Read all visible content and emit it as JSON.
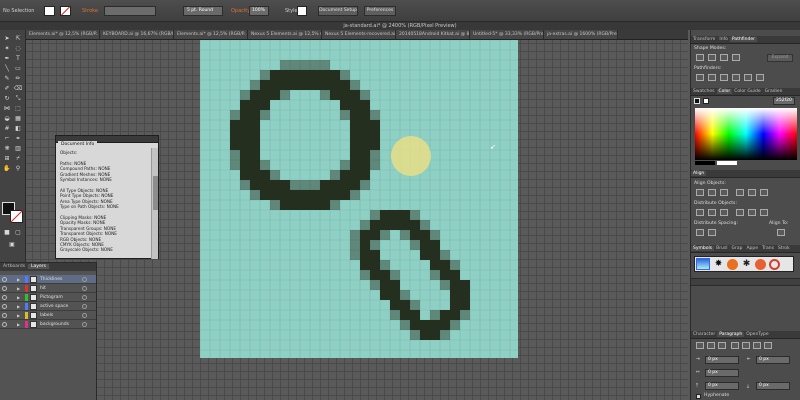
{
  "control_bar": {
    "selection": "No Selection",
    "stroke_label": "Stroke",
    "brush_value": "5 pt. Round",
    "opacity_label": "Opacity",
    "opacity_value": "100%",
    "style_label": "Style",
    "document_setup": "Document Setup",
    "preferences": "Preferences"
  },
  "document_title": "ja-standard.ai* @ 2400% (RGB/Pixel Preview)",
  "tabs": [
    {
      "label": "Elements.ai* @ 12,5% (RGB/P..."
    },
    {
      "label": "KEYBOARD.ai @ 16,67% (RGB/Pixel P..."
    },
    {
      "label": "Elements.ai* @ 12,5% (RGB/P..."
    },
    {
      "label": "Nexus 5 Elements.ai @ 12,5% (RGB/P..."
    },
    {
      "label": "Nexus 5 Elements-recovered.ai @ 6,2..."
    },
    {
      "label": "20140518Android Kitkat.ai @ 8,33% (..."
    },
    {
      "label": "Untitled-5* @ 33,33% (RGB/Previe..."
    },
    {
      "label": "ja-extras.ai @ 1600% (RGB/Previe..."
    }
  ],
  "document_info": {
    "tab": "Document Info",
    "lines": [
      "Objects:",
      "",
      "Paths: NONE",
      "Compound Paths: NONE",
      "Gradient Meshes: NONE",
      "Symbol Instances: NONE",
      "",
      "All Type Objects: NONE",
      "Point Type Objects: NONE",
      "Area Type Objects: NONE",
      "Type on Path Objects: NONE",
      "",
      "Clipping Masks: NONE",
      "Opacity Masks: NONE",
      "Transparent Groups: NONE",
      "Transparent Objects: NONE",
      "RGB Objects: NONE",
      "CMYK Objects: NONE",
      "Grayscale Objects: NONE"
    ]
  },
  "layers_panel": {
    "tabs": [
      "Artboards",
      "Layers"
    ],
    "active_tab": "Layers",
    "layers": [
      {
        "name": "Thicklines",
        "color": "#4f7cff"
      },
      {
        "name": "hit",
        "color": "#e03030"
      },
      {
        "name": "Pictogram",
        "color": "#30c030"
      },
      {
        "name": "active space",
        "color": "#4f7cff"
      },
      {
        "name": "labels",
        "color": "#d4c020"
      },
      {
        "name": "backgrounds",
        "color": "#e03090"
      }
    ]
  },
  "right_panels": {
    "transform_tabs": [
      "Transform",
      "Info",
      "Pathfinder"
    ],
    "active_transform_tab": "Pathfinder",
    "shape_modes": "Shape Modes:",
    "expand": "Expand",
    "pathfinders": "Pathfinders:",
    "swatch_tabs": [
      "Swatches",
      "Color",
      "Color Guide",
      "Gradien"
    ],
    "active_swatch_tab": "Color",
    "hex_value": "252f20",
    "align_tab": "Align",
    "align_objects": "Align Objects:",
    "distribute_objects": "Distribute Objects:",
    "distribute_spacing": "Distribute Spacing:",
    "align_to": "Align To:",
    "symbol_tabs": [
      "Symbols",
      "Brusl",
      "Grap",
      "Appe",
      "Trans",
      "Strok"
    ],
    "active_symbol_tab": "Symbols",
    "char_tabs": [
      "Character",
      "Paragraph",
      "OpenType"
    ],
    "active_char_tab": "Paragraph",
    "spacing_values": [
      "0 px",
      "0 px",
      "0 px",
      "0 px",
      "0 px"
    ],
    "hyphenate": "Hyphenate"
  },
  "colors": {
    "artboard": "#8fd0c5",
    "ink": "#252f20",
    "highlight": "#f0e080"
  }
}
